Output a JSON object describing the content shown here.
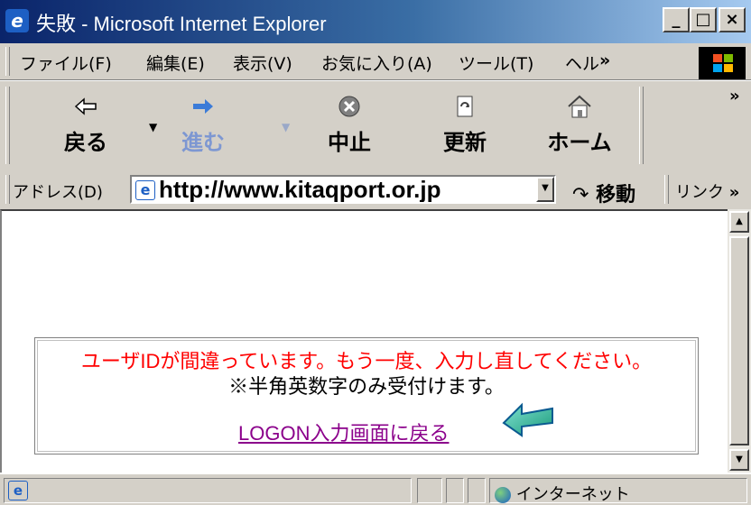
{
  "window": {
    "title": "失敗 - Microsoft Internet Explorer",
    "app_icon": "ie-icon",
    "minimize_label": "_",
    "maximize_label": "□",
    "close_label": "×"
  },
  "menu": {
    "items": [
      {
        "label": "ファイル(F)"
      },
      {
        "label": "編集(E)"
      },
      {
        "label": "表示(V)"
      },
      {
        "label": "お気に入り(A)"
      },
      {
        "label": "ツール(T)"
      },
      {
        "label": "ヘル"
      }
    ],
    "overflow": "»"
  },
  "toolbar": {
    "buttons": [
      {
        "label": "戻る",
        "icon": "back-arrow-icon",
        "enabled": true
      },
      {
        "label": "進む",
        "icon": "forward-arrow-icon",
        "enabled": false
      },
      {
        "label": "中止",
        "icon": "stop-icon",
        "enabled": true
      },
      {
        "label": "更新",
        "icon": "refresh-icon",
        "enabled": true
      },
      {
        "label": "ホーム",
        "icon": "home-icon",
        "enabled": true
      }
    ],
    "overflow": "»"
  },
  "address": {
    "label": "アドレス(D)",
    "url": "http://www.kitaqport.or.jp",
    "go_label": "移動",
    "links_label": "リンク",
    "links_overflow": "»"
  },
  "page": {
    "error_message": "ユーザIDが間違っています。もう一度、入力し直してください。",
    "note": "※半角英数字のみ受付けます。",
    "back_link": "LOGON入力画面に戻る",
    "error_color": "#ff0000",
    "link_color": "#8b008b"
  },
  "status": {
    "zone_label": "インターネット"
  }
}
